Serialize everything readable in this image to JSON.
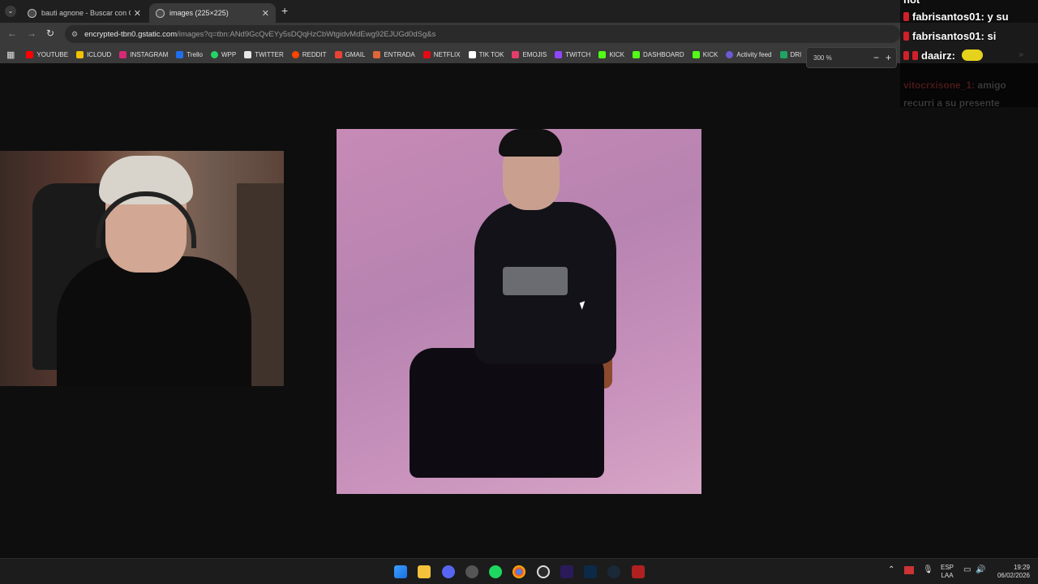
{
  "browser": {
    "tabs": [
      {
        "title": "bauti agnone - Buscar con Goo",
        "active": false
      },
      {
        "title": "images (225×225)",
        "active": true
      }
    ],
    "new_tab": "+",
    "address": {
      "host": "encrypted-tbn0.gstatic.com",
      "path": "/images?q=tbn:ANd9GcQvEYy5sDQqHzCbWtgidvMdEwg92EJUGd0dSg&s"
    },
    "bookmarks": [
      {
        "label": "YOUTUBE",
        "color": "#ff0000"
      },
      {
        "label": "ICLOUD",
        "color": "#f2c200"
      },
      {
        "label": "INSTAGRAM",
        "color": "#d62976"
      },
      {
        "label": "Trello",
        "color": "#1f6feb"
      },
      {
        "label": "WPP",
        "color": "#25d366"
      },
      {
        "label": "TWITTER",
        "color": "#e7e7e7"
      },
      {
        "label": "REDDIT",
        "color": "#ff4500"
      },
      {
        "label": "GMAIL",
        "color": "#ea4335"
      },
      {
        "label": "ENTRADA",
        "color": "#e0663a"
      },
      {
        "label": "NETFLIX",
        "color": "#e50914"
      },
      {
        "label": "TIK TOK",
        "color": "#ffffff"
      },
      {
        "label": "EMOJIS",
        "color": "#e53d6b"
      },
      {
        "label": "TWITCH",
        "color": "#9146ff"
      },
      {
        "label": "KICK",
        "color": "#53fc18"
      },
      {
        "label": "DASHBOARD",
        "color": "#53fc18"
      },
      {
        "label": "KICK",
        "color": "#53fc18"
      },
      {
        "label": "Activity feed",
        "color": "#6b5bd6"
      },
      {
        "label": "DRI",
        "color": "#1fa463"
      }
    ],
    "zoom": {
      "label": "300 %",
      "minus": "−",
      "plus": "+"
    }
  },
  "chat": {
    "messages": [
      {
        "user": "fabrisantos01:",
        "text": "y su"
      },
      {
        "user": "fabrisantos01:",
        "text": "si"
      },
      {
        "user": "daairz:",
        "text": ""
      },
      {
        "user": "vitocrxisone_1:",
        "text": "amigo"
      },
      {
        "user": "",
        "text": "recurri a su presente"
      }
    ],
    "top_fragment": "not"
  },
  "taskbar": {
    "lang_top": "ESP",
    "lang_bottom": "LAA",
    "time": "19:29",
    "date": "06/02/2026"
  }
}
